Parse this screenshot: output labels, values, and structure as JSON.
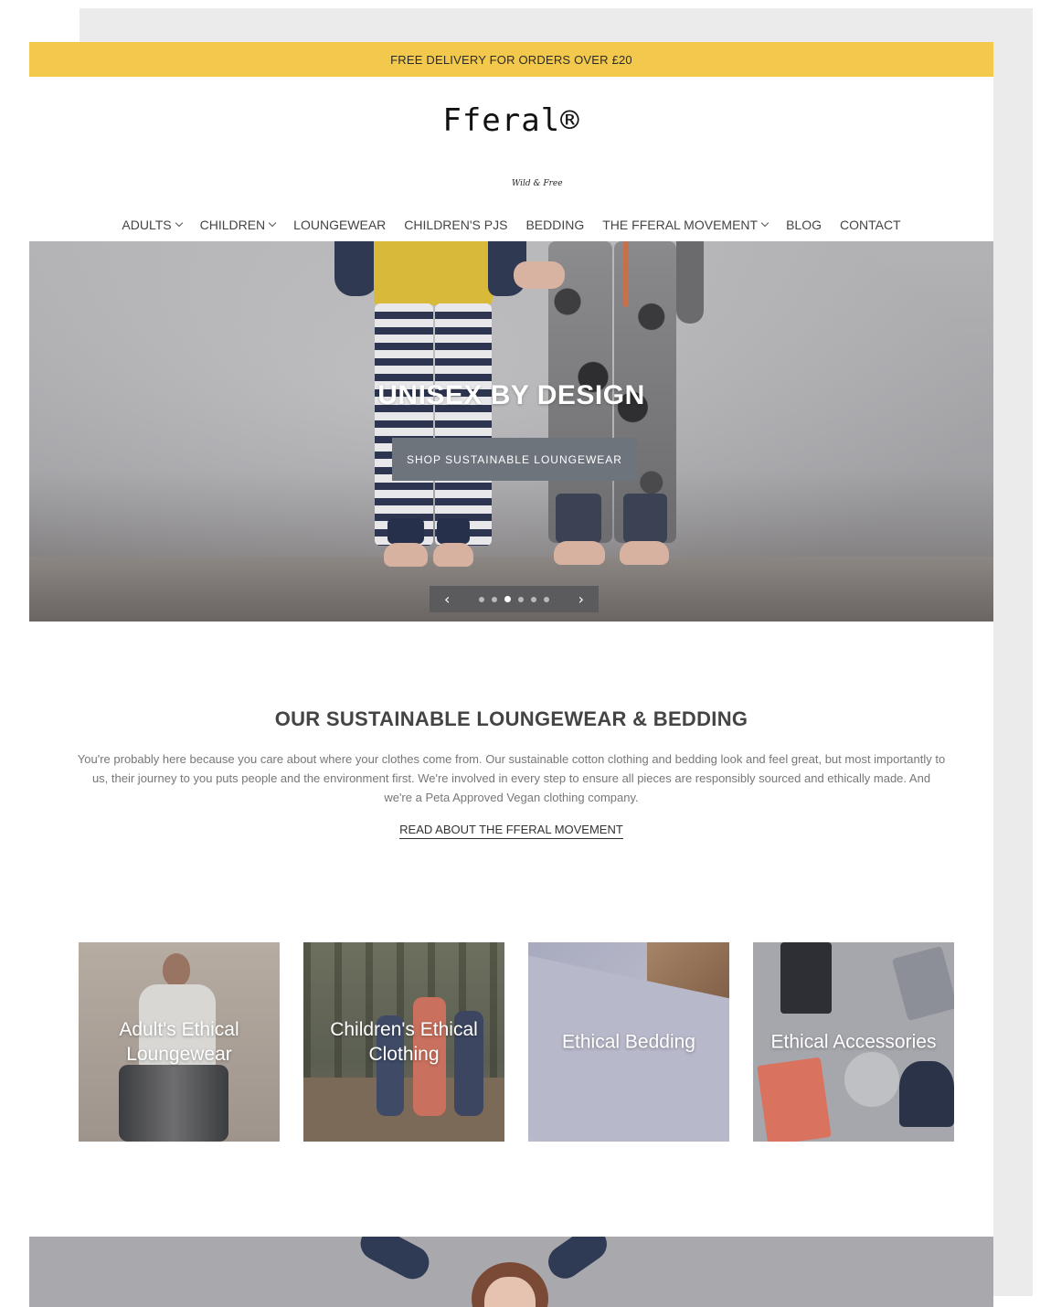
{
  "announcement": "FREE DELIVERY FOR ORDERS OVER £20",
  "brand": {
    "logo_text": "Fferal®",
    "tagline": "Wild & Free"
  },
  "nav": [
    {
      "label": "ADULTS",
      "dropdown": true
    },
    {
      "label": "CHILDREN",
      "dropdown": true
    },
    {
      "label": "LOUNGEWEAR",
      "dropdown": false
    },
    {
      "label": "CHILDREN'S PJS",
      "dropdown": false
    },
    {
      "label": "BEDDING",
      "dropdown": false
    },
    {
      "label": "THE FFERAL MOVEMENT",
      "dropdown": true
    },
    {
      "label": "BLOG",
      "dropdown": false
    },
    {
      "label": "CONTACT",
      "dropdown": false
    }
  ],
  "hero": {
    "title": "UNISEX BY DESIGN",
    "button": "SHOP SUSTAINABLE LOUNGEWEAR",
    "prev_icon": "chevron-left-icon",
    "next_icon": "chevron-right-icon",
    "slide_count": 6,
    "active_slide": 3
  },
  "intro": {
    "title": "OUR SUSTAINABLE LOUNGEWEAR & BEDDING",
    "body": "You're probably here because you care about where your clothes come from. Our sustainable cotton clothing and bedding look and feel great, but most importantly to us, their journey to you puts people and the environment first. We're involved in every step to ensure all pieces are responsibly sourced and ethically made. And we're a Peta Approved Vegan clothing company.",
    "link": "READ ABOUT THE FFERAL MOVEMENT"
  },
  "categories": [
    {
      "label": "Adult's Ethical Loungewear"
    },
    {
      "label": "Children's Ethical Clothing"
    },
    {
      "label": "Ethical Bedding"
    },
    {
      "label": "Ethical Accessories"
    }
  ],
  "colors": {
    "announcement_bg": "#f2c94c",
    "hero_button_bg": "#6d747c",
    "slider_bg": "#5b5b5e"
  }
}
